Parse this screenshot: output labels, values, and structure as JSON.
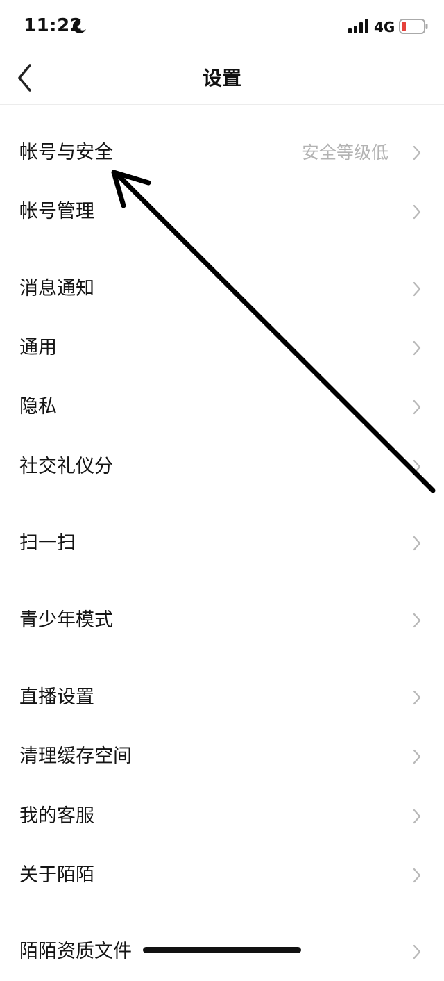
{
  "status_bar": {
    "time": "11:22",
    "network": "4G",
    "icons": [
      "moon-icon",
      "signal-bars-icon",
      "battery-low-icon"
    ],
    "battery_color": "#e5413b"
  },
  "nav": {
    "title": "设置",
    "back_icon": "back-chevron-icon"
  },
  "settings": {
    "items": [
      {
        "label": "帐号与安全",
        "value": "安全等级低"
      },
      {
        "label": "帐号管理"
      },
      {
        "label": "消息通知"
      },
      {
        "label": "通用"
      },
      {
        "label": "隐私"
      },
      {
        "label": "社交礼仪分"
      },
      {
        "label": "扫一扫"
      },
      {
        "label": "青少年模式"
      },
      {
        "label": "直播设置"
      },
      {
        "label": "清理缓存空间"
      },
      {
        "label": "我的客服"
      },
      {
        "label": "关于陌陌"
      },
      {
        "label": "陌陌资质文件"
      }
    ]
  },
  "overlay": {
    "annotation": "arrow-pointing-to-account-security",
    "color": "#000000"
  }
}
